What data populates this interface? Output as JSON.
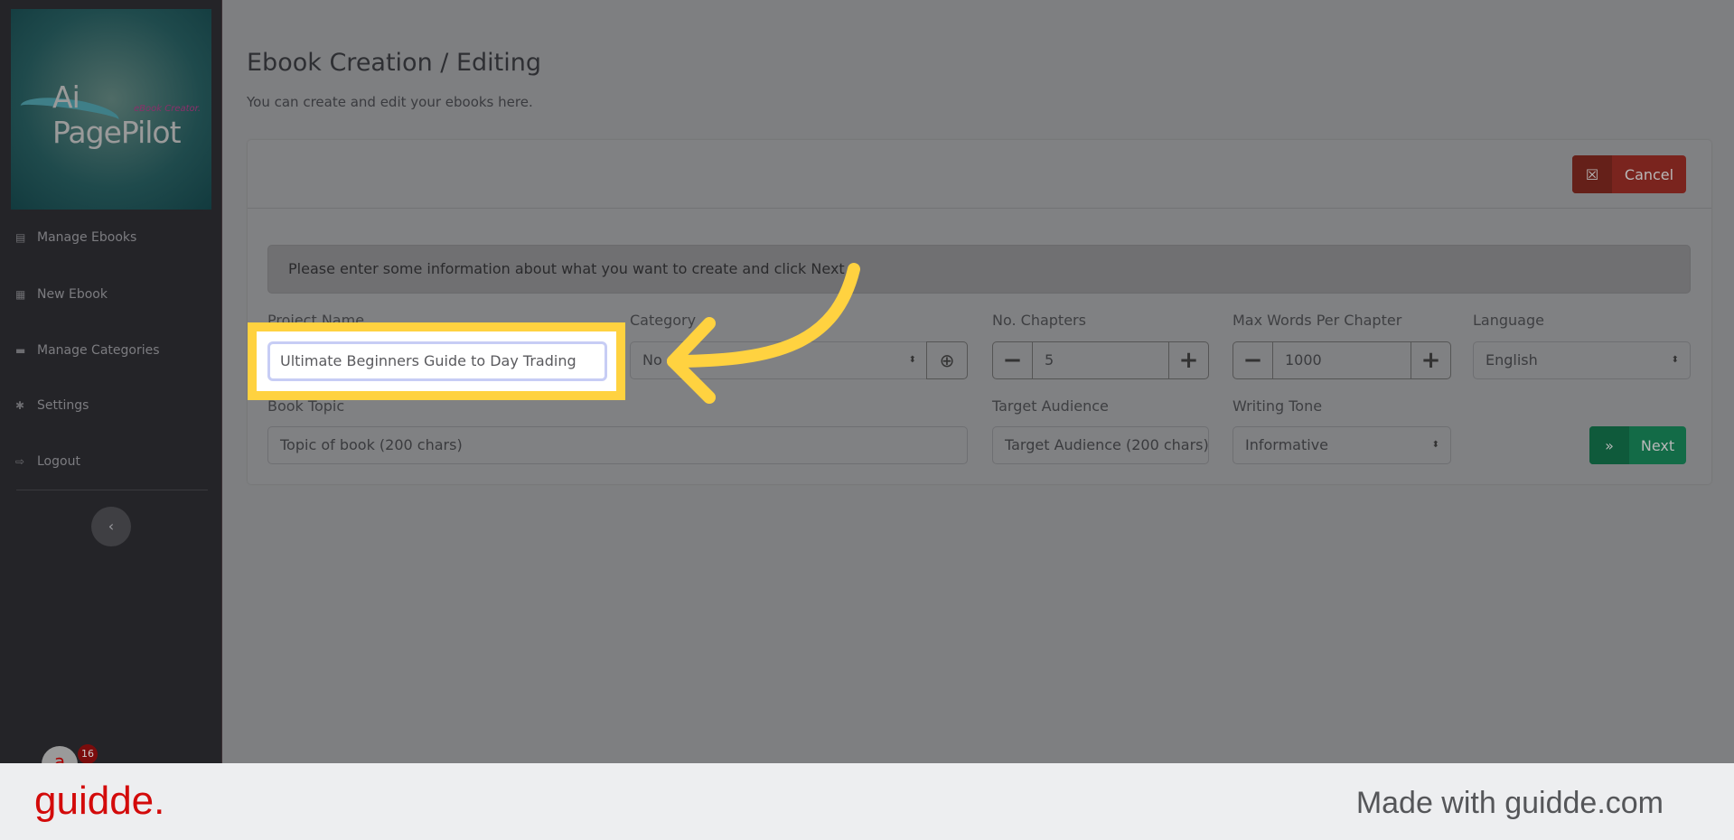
{
  "sidebar": {
    "logo_text": "Ai PagePilot",
    "logo_sub": "eBook Creator.",
    "items": [
      {
        "label": "Manage Ebooks",
        "icon": "clipboard-icon"
      },
      {
        "label": "New Ebook",
        "icon": "book-icon"
      },
      {
        "label": "Manage Categories",
        "icon": "folder-plus-icon"
      },
      {
        "label": "Settings",
        "icon": "gear-icon"
      },
      {
        "label": "Logout",
        "icon": "sign-out-icon"
      }
    ],
    "collapse_icon": "chevron-left-icon",
    "notification_count": "16"
  },
  "page": {
    "title": "Ebook Creation / Editing",
    "subtitle": "You can create and edit your ebooks here."
  },
  "card": {
    "cancel_label": "Cancel",
    "info": "Please enter some information about what you want to create and click Next",
    "next_label": "Next"
  },
  "form": {
    "project_name": {
      "label": "Project Name",
      "value": "Ultimate Beginners Guide to Day Trading"
    },
    "category": {
      "label": "Category",
      "value": "No"
    },
    "chapters": {
      "label": "No. Chapters",
      "value": "5"
    },
    "max_words": {
      "label": "Max Words Per Chapter",
      "value": "1000"
    },
    "language": {
      "label": "Language",
      "value": "English"
    },
    "book_topic": {
      "label": "Book Topic",
      "placeholder": "Topic of book (200 chars)"
    },
    "target_audience": {
      "label": "Target Audience",
      "placeholder": "Target Audience (200 chars)"
    },
    "writing_tone": {
      "label": "Writing Tone",
      "value": "Informative"
    }
  },
  "footer": {
    "brand": "guidde.",
    "made_with": "Made with guidde.com"
  },
  "colors": {
    "highlight": "#ffd240",
    "cancel": "#7a241e",
    "next": "#136b47",
    "brand": "#d30a0a"
  }
}
